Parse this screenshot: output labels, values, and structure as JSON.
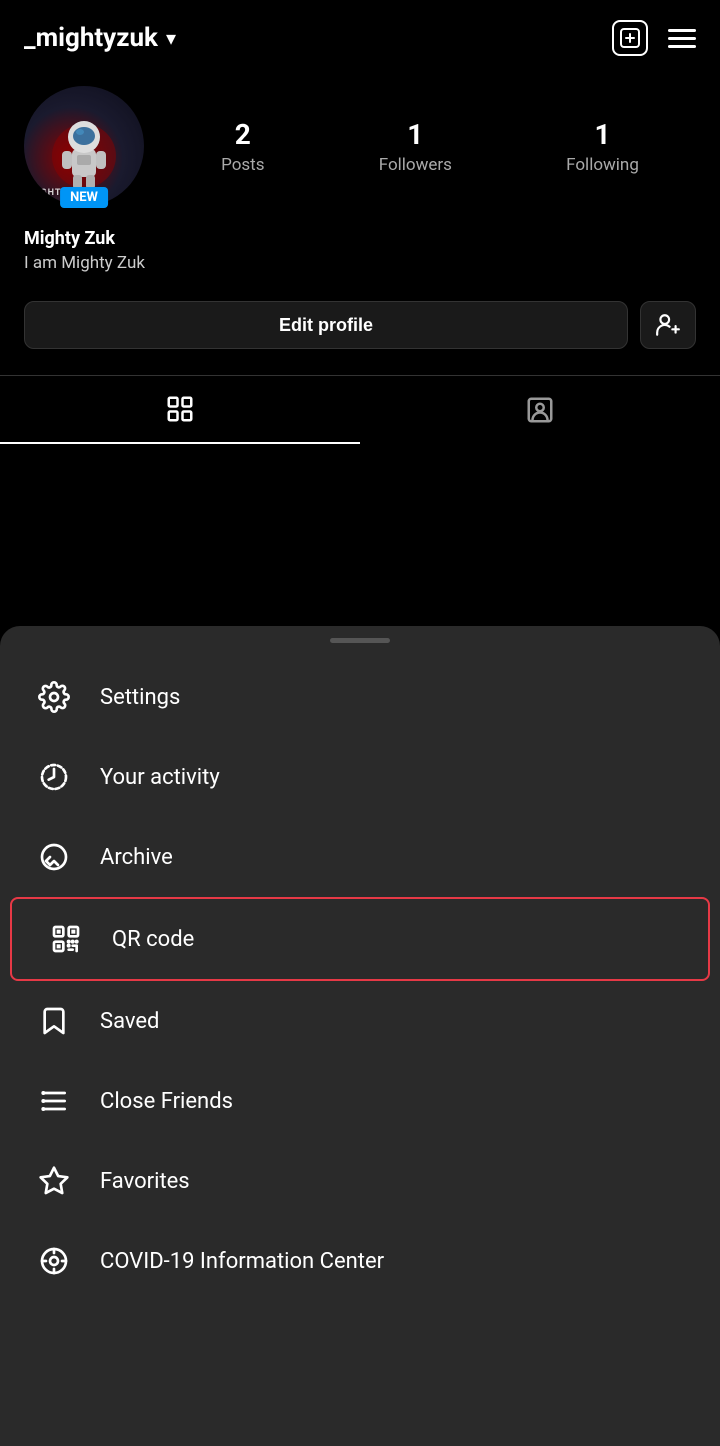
{
  "header": {
    "username": "_mightyzuk",
    "chevron": "▾",
    "new_post_icon": "+",
    "menu_icon": "≡"
  },
  "profile": {
    "display_name": "Mighty Zuk",
    "bio": "I am Mighty Zuk",
    "new_badge": "NEW",
    "stats": [
      {
        "number": "2",
        "label": "Posts"
      },
      {
        "number": "1",
        "label": "Followers"
      },
      {
        "number": "1",
        "label": "Following"
      }
    ]
  },
  "actions": {
    "edit_profile": "Edit profile",
    "add_friend_icon": "person+"
  },
  "tabs": [
    {
      "icon": "grid",
      "active": true
    },
    {
      "icon": "person-tag",
      "active": false
    }
  ],
  "drawer": {
    "drag_handle": true,
    "menu_items": [
      {
        "id": "settings",
        "label": "Settings",
        "icon": "settings"
      },
      {
        "id": "your-activity",
        "label": "Your activity",
        "icon": "activity"
      },
      {
        "id": "archive",
        "label": "Archive",
        "icon": "archive"
      },
      {
        "id": "qr-code",
        "label": "QR code",
        "icon": "qr",
        "highlighted": true
      },
      {
        "id": "saved",
        "label": "Saved",
        "icon": "bookmark"
      },
      {
        "id": "close-friends",
        "label": "Close Friends",
        "icon": "close-friends"
      },
      {
        "id": "favorites",
        "label": "Favorites",
        "icon": "star"
      },
      {
        "id": "covid",
        "label": "COVID-19 Information Center",
        "icon": "covid"
      }
    ]
  }
}
